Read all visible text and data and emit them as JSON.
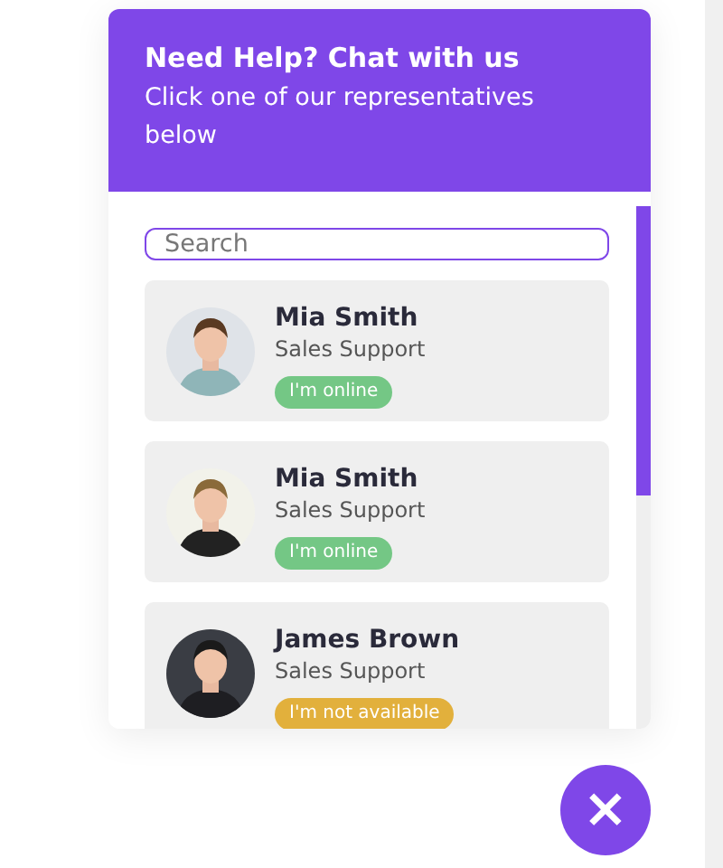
{
  "header": {
    "title": "Need Help? Chat with us",
    "subtitle": "Click one of our representatives below"
  },
  "search": {
    "placeholder": "Search"
  },
  "representatives": [
    {
      "name": "Mia Smith",
      "role": "Sales Support",
      "status": "I'm online",
      "color": "#74c785"
    },
    {
      "name": "Mia Smith",
      "role": "Sales Support",
      "status": "I'm online",
      "color": "#74c785"
    },
    {
      "name": "James Brown",
      "role": "Sales Support",
      "status": "I'm not available",
      "color": "#e2b03c"
    }
  ],
  "close_button": {
    "label": "×"
  }
}
